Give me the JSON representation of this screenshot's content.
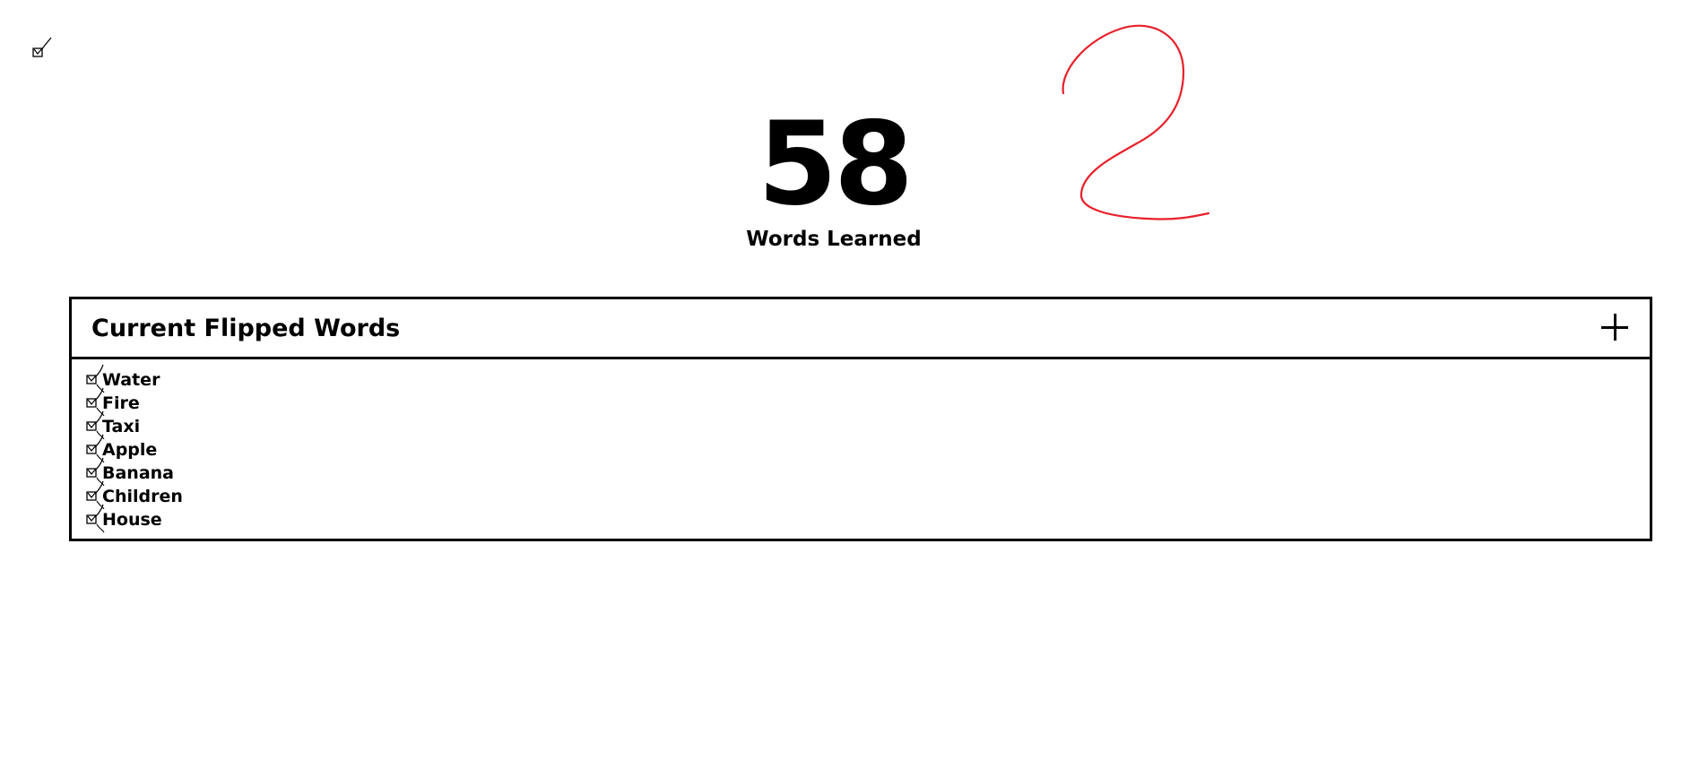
{
  "stats": {
    "words_learned_count": "58",
    "words_learned_label": "Words Learned"
  },
  "annotation": {
    "handwritten_mark": "2",
    "color": "#e8202a"
  },
  "panel": {
    "title": "Current Flipped Words",
    "add_icon": "plus-icon"
  },
  "words": [
    {
      "label": "Water",
      "checked": true
    },
    {
      "label": "Fire",
      "checked": true
    },
    {
      "label": "Taxi",
      "checked": true
    },
    {
      "label": "Apple",
      "checked": true
    },
    {
      "label": "Banana",
      "checked": true
    },
    {
      "label": "Children",
      "checked": true
    },
    {
      "label": "House",
      "checked": true
    }
  ]
}
